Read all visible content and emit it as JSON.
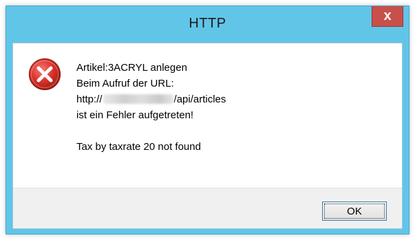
{
  "window": {
    "title": "HTTP",
    "close_label": "x"
  },
  "icon": {
    "name": "error-icon",
    "color": "#d8302a"
  },
  "message": {
    "line1": "Artikel:3ACRYL anlegen",
    "line2": "Beim Aufruf der URL:",
    "url_prefix": "http://",
    "url_suffix": "/api/articles",
    "line4": "ist ein Fehler aufgetreten!",
    "line5": "Tax by taxrate 20 not found"
  },
  "buttons": {
    "ok_label": "OK"
  }
}
